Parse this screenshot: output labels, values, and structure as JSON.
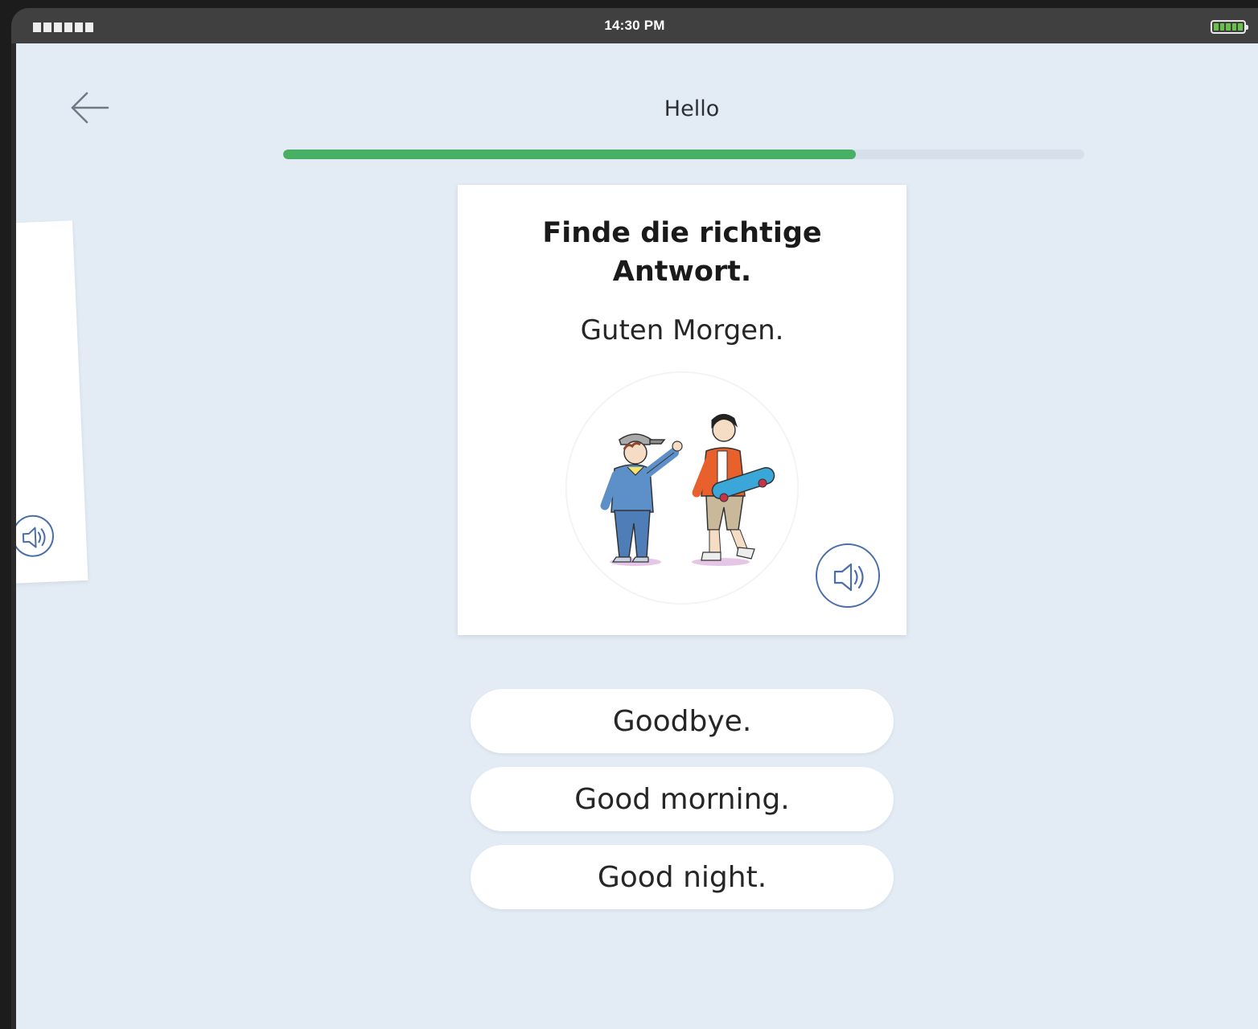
{
  "status_bar": {
    "time": "14:30 PM",
    "signal_icon": "signal-bars-icon",
    "battery_icon": "battery-full-icon",
    "battery_color": "#68c24a"
  },
  "header": {
    "back_icon": "arrow-left-icon",
    "title": "Hello"
  },
  "progress": {
    "value": 0.715,
    "fill_color": "#48b065",
    "track_color": "#d5e0eb"
  },
  "question": {
    "instruction": "Finde die richtige Antwort.",
    "prompt": "Guten Morgen.",
    "illustration": "two-boys-greeting-illustration",
    "audio_icon": "speaker-icon"
  },
  "answers": [
    {
      "label": "Goodbye."
    },
    {
      "label": "Good morning."
    },
    {
      "label": "Good night."
    }
  ],
  "colors": {
    "background": "#e3ecf5",
    "accent_blue": "#4a6fa8"
  }
}
